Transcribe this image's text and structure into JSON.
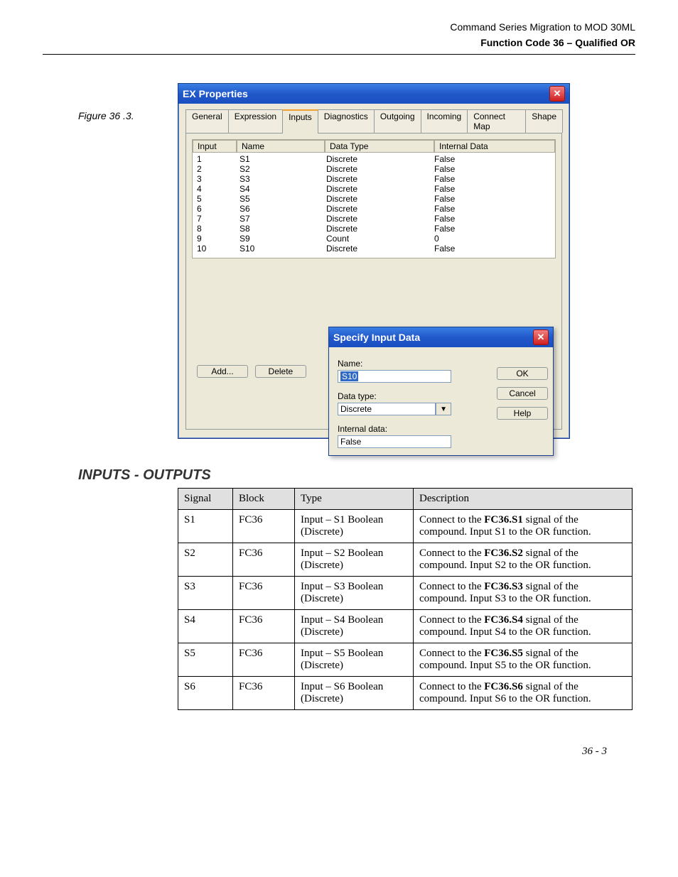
{
  "header": {
    "doc_title": "Command Series Migration to MOD 30ML",
    "chapter": "Function Code 36 – Qualified OR"
  },
  "figure_label": "Figure 36 .3.",
  "window": {
    "title": "EX Properties",
    "close_icon_text": "✕",
    "tabs": [
      "General",
      "Expression",
      "Inputs",
      "Diagnostics",
      "Outgoing",
      "Incoming",
      "Connect Map",
      "Shape"
    ],
    "active_tab_index": 2,
    "list_headers": [
      "Input",
      "Name",
      "Data Type",
      "Internal Data"
    ],
    "list_rows": [
      {
        "input": "1",
        "name": "S1",
        "type": "Discrete",
        "idata": "False"
      },
      {
        "input": "2",
        "name": "S2",
        "type": "Discrete",
        "idata": "False"
      },
      {
        "input": "3",
        "name": "S3",
        "type": "Discrete",
        "idata": "False"
      },
      {
        "input": "4",
        "name": "S4",
        "type": "Discrete",
        "idata": "False"
      },
      {
        "input": "5",
        "name": "S5",
        "type": "Discrete",
        "idata": "False"
      },
      {
        "input": "6",
        "name": "S6",
        "type": "Discrete",
        "idata": "False"
      },
      {
        "input": "7",
        "name": "S7",
        "type": "Discrete",
        "idata": "False"
      },
      {
        "input": "8",
        "name": "S8",
        "type": "Discrete",
        "idata": "False"
      },
      {
        "input": "9",
        "name": "S9",
        "type": "Count",
        "idata": "0"
      },
      {
        "input": "10",
        "name": "S10",
        "type": "Discrete",
        "idata": "False"
      }
    ],
    "add_label": "Add...",
    "delete_label": "Delete"
  },
  "popup": {
    "title": "Specify Input Data",
    "close_icon_text": "✕",
    "name_label": "Name:",
    "name_value": "S10",
    "datatype_label": "Data type:",
    "datatype_value": "Discrete",
    "internal_label": "Internal data:",
    "internal_value": "False",
    "ok_label": "OK",
    "cancel_label": "Cancel",
    "help_label": "Help"
  },
  "io_section": {
    "heading": "INPUTS - OUTPUTS",
    "columns": [
      "Signal",
      "Block",
      "Type",
      "Description"
    ],
    "rows": [
      {
        "signal": "S1",
        "block": "FC36",
        "type": "Input – S1 Boolean (Discrete)",
        "desc_bold": "FC36.S1",
        "desc_pre": "Connect to the ",
        "desc_post": " signal of the compound. Input S1 to the OR function."
      },
      {
        "signal": "S2",
        "block": "FC36",
        "type": "Input – S2 Boolean (Discrete)",
        "desc_bold": "FC36.S2",
        "desc_pre": "Connect to the ",
        "desc_post": " signal of the compound. Input S2 to the OR function."
      },
      {
        "signal": "S3",
        "block": "FC36",
        "type": "Input – S3 Boolean (Discrete)",
        "desc_bold": "FC36.S3",
        "desc_pre": "Connect to the ",
        "desc_post": " signal of the compound. Input S3 to the OR function."
      },
      {
        "signal": "S4",
        "block": "FC36",
        "type": "Input – S4 Boolean (Discrete)",
        "desc_bold": "FC36.S4",
        "desc_pre": "Connect to the ",
        "desc_post": " signal of the compound. Input S4 to the OR function."
      },
      {
        "signal": "S5",
        "block": "FC36",
        "type": "Input – S5 Boolean (Discrete)",
        "desc_bold": "FC36.S5",
        "desc_pre": "Connect to the ",
        "desc_post": " signal of the compound. Input S5 to the OR function."
      },
      {
        "signal": "S6",
        "block": "FC36",
        "type": "Input – S6 Boolean (Discrete)",
        "desc_bold": "FC36.S6",
        "desc_pre": "Connect to the ",
        "desc_post": " signal of the compound. Input S6 to the OR function."
      }
    ]
  },
  "footer_page": "36 - 3"
}
